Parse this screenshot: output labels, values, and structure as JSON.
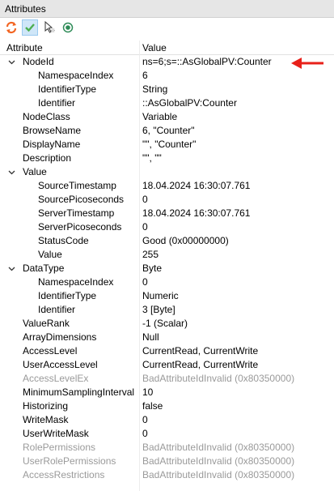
{
  "panel": {
    "title": "Attributes"
  },
  "toolbar": {
    "refresh_icon": "refresh-icon",
    "check_icon": "check-icon",
    "cursor_icon": "pointer-icon",
    "record_icon": "radio-icon",
    "colors": {
      "refresh": "#f26522",
      "check": "#4caf50",
      "record": "#2e8b57"
    }
  },
  "table": {
    "headers": {
      "attribute": "Attribute",
      "value": "Value"
    },
    "rows": [
      {
        "name": "NodeId",
        "value": "ns=6;s=::AsGlobalPV:Counter",
        "level": 0,
        "expanded": true
      },
      {
        "name": "NamespaceIndex",
        "value": "6",
        "level": 1
      },
      {
        "name": "IdentifierType",
        "value": "String",
        "level": 1
      },
      {
        "name": "Identifier",
        "value": "::AsGlobalPV:Counter",
        "level": 1
      },
      {
        "name": "NodeClass",
        "value": "Variable",
        "level": 0
      },
      {
        "name": "BrowseName",
        "value": "6, \"Counter\"",
        "level": 0
      },
      {
        "name": "DisplayName",
        "value": "\"\", \"Counter\"",
        "level": 0
      },
      {
        "name": "Description",
        "value": "\"\", \"\"",
        "level": 0
      },
      {
        "name": "Value",
        "value": "",
        "level": 0,
        "expanded": true
      },
      {
        "name": "SourceTimestamp",
        "value": "18.04.2024 16:30:07.761",
        "level": 1
      },
      {
        "name": "SourcePicoseconds",
        "value": "0",
        "level": 1
      },
      {
        "name": "ServerTimestamp",
        "value": "18.04.2024 16:30:07.761",
        "level": 1
      },
      {
        "name": "ServerPicoseconds",
        "value": "0",
        "level": 1
      },
      {
        "name": "StatusCode",
        "value": "Good (0x00000000)",
        "level": 1
      },
      {
        "name": "Value",
        "value": "255",
        "level": 1
      },
      {
        "name": "DataType",
        "value": "Byte",
        "level": 0,
        "expanded": true
      },
      {
        "name": "NamespaceIndex",
        "value": "0",
        "level": 1
      },
      {
        "name": "IdentifierType",
        "value": "Numeric",
        "level": 1
      },
      {
        "name": "Identifier",
        "value": "3 [Byte]",
        "level": 1
      },
      {
        "name": "ValueRank",
        "value": "-1 (Scalar)",
        "level": 0
      },
      {
        "name": "ArrayDimensions",
        "value": "Null",
        "level": 0
      },
      {
        "name": "AccessLevel",
        "value": "CurrentRead, CurrentWrite",
        "level": 0
      },
      {
        "name": "UserAccessLevel",
        "value": "CurrentRead, CurrentWrite",
        "level": 0
      },
      {
        "name": "AccessLevelEx",
        "value": "BadAttributeIdInvalid (0x80350000)",
        "level": 0,
        "disabled": true
      },
      {
        "name": "MinimumSamplingInterval",
        "value": "10",
        "level": 0
      },
      {
        "name": "Historizing",
        "value": "false",
        "level": 0
      },
      {
        "name": "WriteMask",
        "value": "0",
        "level": 0
      },
      {
        "name": "UserWriteMask",
        "value": "0",
        "level": 0
      },
      {
        "name": "RolePermissions",
        "value": "BadAttributeIdInvalid (0x80350000)",
        "level": 0,
        "disabled": true
      },
      {
        "name": "UserRolePermissions",
        "value": "BadAttributeIdInvalid (0x80350000)",
        "level": 0,
        "disabled": true
      },
      {
        "name": "AccessRestrictions",
        "value": "BadAttributeIdInvalid (0x80350000)",
        "level": 0,
        "disabled": true
      }
    ]
  },
  "annotation": {
    "arrow_color": "#e8201a"
  }
}
